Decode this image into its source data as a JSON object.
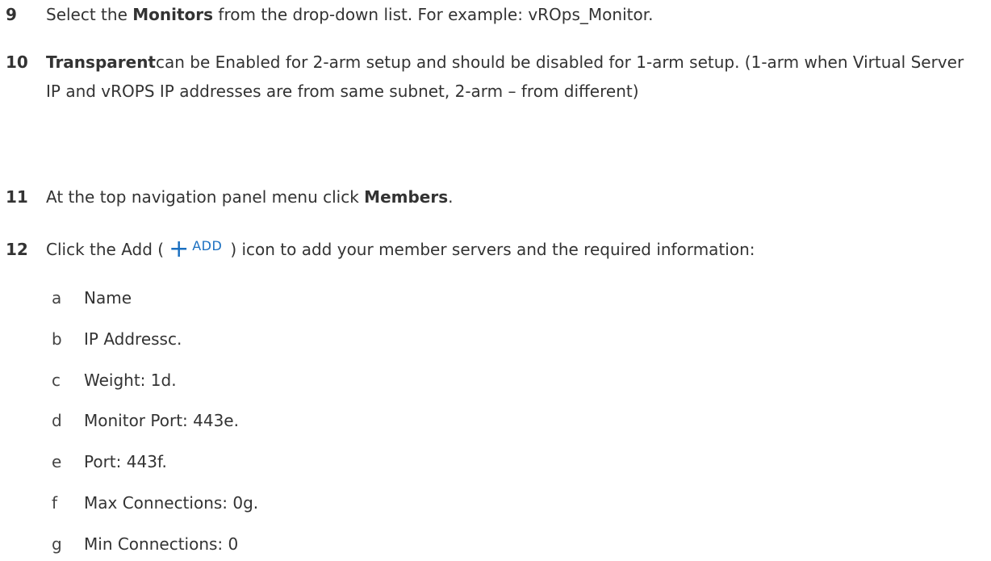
{
  "steps": [
    {
      "number": "9",
      "pre": "Select the ",
      "bold": "Monitors",
      "post": " from the drop-down list. For example: vROps_Monitor."
    },
    {
      "number": "10",
      "bold": "Transparent",
      "post": "can be Enabled for 2-arm setup and should be disabled for 1-arm setup. (1-arm when Virtual Server IP and vROPS IP addresses are from same subnet, 2-arm – from different)"
    },
    {
      "number": "11",
      "pre": "At the top navigation panel menu click ",
      "bold": "Members",
      "post": "."
    },
    {
      "number": "12",
      "pre": "Click the Add (",
      "icon_plus": "+",
      "icon_label": "ADD",
      "post": ") icon to add your member servers and the required information:"
    }
  ],
  "add_icon": {
    "icon": "plus-icon",
    "color": "#1a6fc0"
  },
  "sub_items": [
    {
      "letter": "a",
      "text": "Name"
    },
    {
      "letter": "b",
      "text": "IP Addressc."
    },
    {
      "letter": "c",
      "text": "Weight: 1d."
    },
    {
      "letter": "d",
      "text": "Monitor Port: 443e."
    },
    {
      "letter": "e",
      "text": "Port: 443f."
    },
    {
      "letter": "f",
      "text": "Max Connections: 0g."
    },
    {
      "letter": "g",
      "text": "Min Connections: 0"
    }
  ]
}
